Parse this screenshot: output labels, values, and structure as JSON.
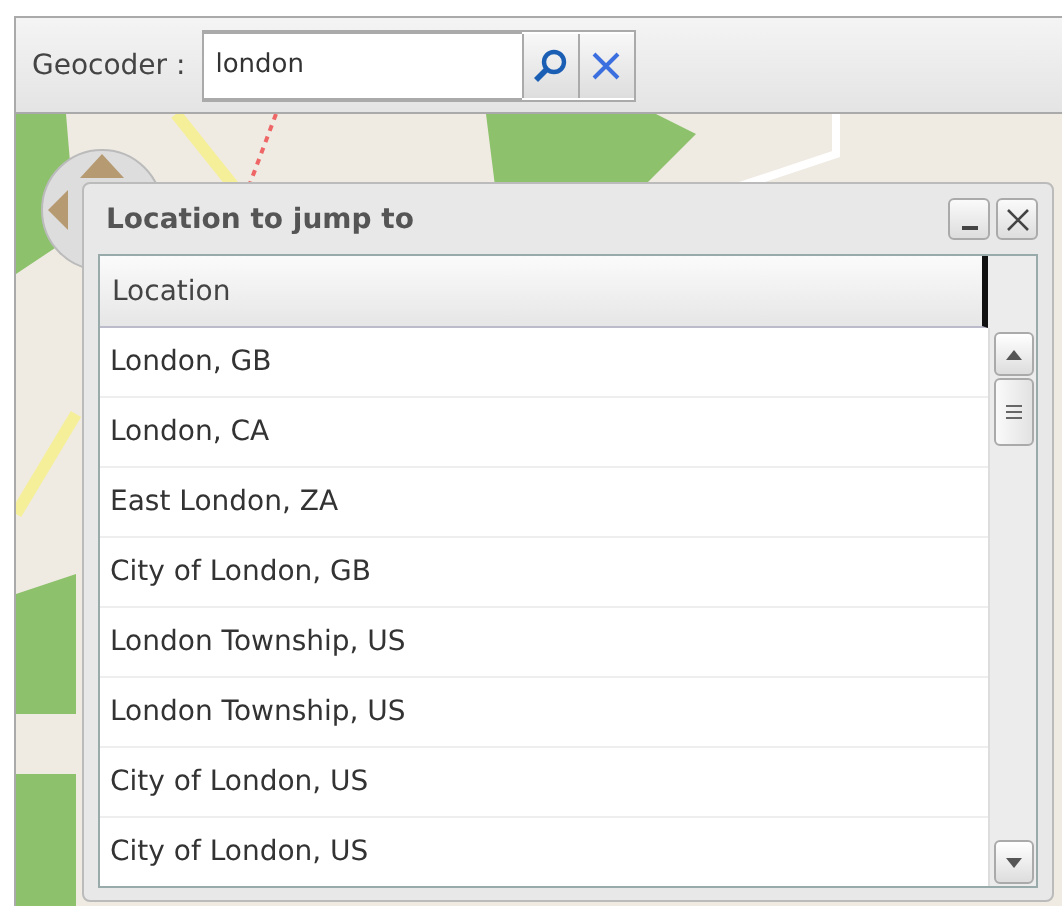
{
  "geocoder": {
    "label": "Geocoder :",
    "value": "london"
  },
  "dialog": {
    "title": "Location to jump to",
    "table": {
      "columns": [
        "Location"
      ],
      "rows": [
        {
          "location": "London, GB"
        },
        {
          "location": "London, CA"
        },
        {
          "location": "East London, ZA"
        },
        {
          "location": "City of London, GB"
        },
        {
          "location": "London Township, US"
        },
        {
          "location": "London Township, US"
        },
        {
          "location": "City of London, US"
        },
        {
          "location": "City of London, US"
        }
      ]
    }
  }
}
